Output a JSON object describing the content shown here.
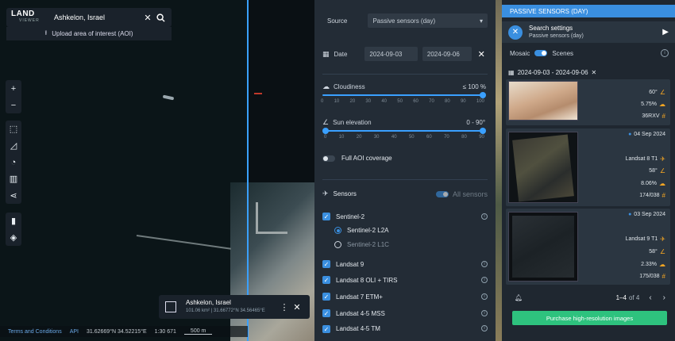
{
  "map": {
    "logo_top": "LAND",
    "logo_bottom": "VIEWER",
    "location_title": "Ashkelon, Israel",
    "upload_label": "Upload area of interest (AOI)",
    "aoi_card": {
      "name": "Ashkelon, Israel",
      "meta": "101.06 km² | 31.66772°N 34.56465°E"
    },
    "bottom": {
      "terms": "Terms and Conditions",
      "api": "API",
      "coords": "31.62669°N 34.52215°E",
      "scale_ratio": "1:30 671",
      "scale_bar": "500 m"
    }
  },
  "panel": {
    "source_label": "Source",
    "source_value": "Passive sensors (day)",
    "date_label": "Date",
    "date_from": "2024-09-03",
    "date_to": "2024-09-06",
    "cloudiness_label": "Cloudiness",
    "cloudiness_value": "≤ 100 %",
    "cloudiness_fraction": 1.0,
    "cloud_ticks": [
      "0",
      "10",
      "20",
      "30",
      "40",
      "50",
      "60",
      "70",
      "80",
      "90",
      "100"
    ],
    "sun_label": "Sun elevation",
    "sun_value": "0 - 90°",
    "sun_range": [
      0,
      90
    ],
    "sun_ticks": [
      "0",
      "10",
      "20",
      "30",
      "40",
      "50",
      "60",
      "70",
      "80",
      "90"
    ],
    "full_aoi_label": "Full AOI coverage",
    "sensors_label": "Sensors",
    "all_sensors_label": "All sensors",
    "sensors": [
      {
        "label": "Sentinel-2",
        "checked": true
      },
      {
        "label": "Sentinel-2 L2A",
        "radio": true,
        "selected": true
      },
      {
        "label": "Sentinel-2 L1C",
        "radio": true,
        "selected": false
      },
      {
        "label": "Landsat 9",
        "checked": true
      },
      {
        "label": "Landsat 8 OLI + TIRS",
        "checked": true
      },
      {
        "label": "Landsat 7 ETM+",
        "checked": true
      },
      {
        "label": "Landsat 4-5 MSS",
        "checked": true
      },
      {
        "label": "Landsat 4-5 TM",
        "checked": true
      }
    ]
  },
  "results": {
    "header": "PASSIVE SENSORS (DAY)",
    "search_title": "Search settings",
    "search_sub": "Passive sensors (day)",
    "mosaic_label": "Mosaic",
    "scenes_label": "Scenes",
    "date_range": "2024-09-03 - 2024-09-06",
    "scene0": {
      "sun": "60°",
      "cloud": "5.75%",
      "tile": "36RXV"
    },
    "scene1": {
      "date": "04 Sep 2024",
      "sat": "Landsat 8 T1",
      "sun": "58°",
      "cloud": "8.06%",
      "tile": "174/038"
    },
    "scene2": {
      "date": "03 Sep 2024",
      "sat": "Landsat 9 T1",
      "sun": "58°",
      "cloud": "2.33%",
      "tile": "175/038"
    },
    "pagination": "1–4",
    "of_label": "of 4",
    "purchase_label": "Purchase high-resolution images"
  },
  "colors": {
    "accent": "#3a8fe0",
    "buy": "#2ec27e",
    "panel": "#232c36"
  }
}
